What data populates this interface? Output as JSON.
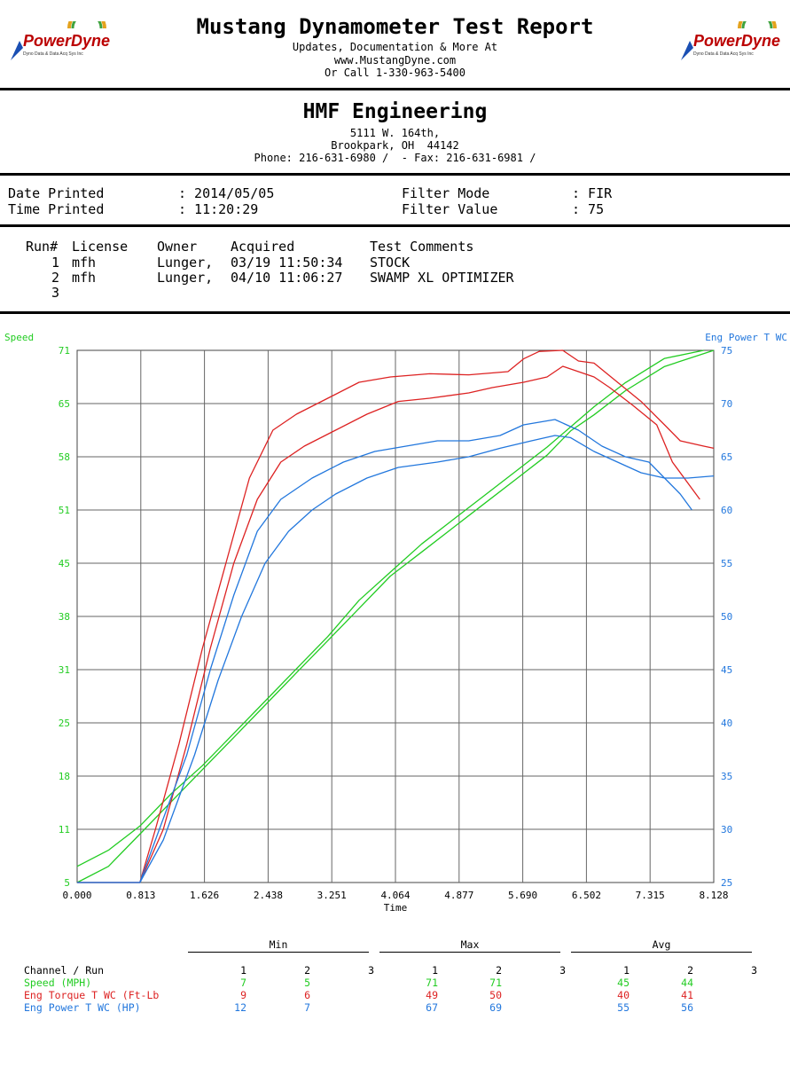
{
  "header": {
    "title": "Mustang Dynamometer Test Report",
    "line1": "Updates, Documentation & More At",
    "line2": "www.MustangDyne.com",
    "line3": "Or Call 1-330-963-5400",
    "logo_text": "PowerDyne",
    "logo_small": "Dyno Data & Data Acq Sys Inc"
  },
  "company": {
    "name": "HMF Engineering",
    "address1": "5111 W. 164th,",
    "address2": "Brookpark, OH  44142",
    "phone": "Phone: 216-631-6980 /  - Fax: 216-631-6981 /"
  },
  "info": {
    "date_label": "Date Printed",
    "date_value": ": 2014/05/05",
    "time_label": "Time Printed",
    "time_value": ": 11:20:29",
    "filter_mode_label": "Filter Mode",
    "filter_mode_value": ": FIR",
    "filter_value_label": "Filter Value",
    "filter_value_value": ": 75"
  },
  "runs": {
    "headers": [
      "Run#",
      "License",
      "Owner",
      "Acquired",
      "Test Comments"
    ],
    "rows": [
      [
        "1",
        "mfh",
        "Lunger,",
        "03/19 11:50:34",
        "STOCK"
      ],
      [
        "2",
        "mfh",
        "Lunger,",
        "04/10 11:06:27",
        "SWAMP XL OPTIMIZER"
      ],
      [
        "3",
        "",
        "",
        "",
        ""
      ]
    ]
  },
  "colors": {
    "speed": "#22cc22",
    "torque": "#dd2222",
    "power": "#2277dd",
    "grid": "#666666"
  },
  "chart_data": {
    "type": "line",
    "xlabel": "Time",
    "ylabel_left": "Speed",
    "ylabel_right": "Eng Power T WC",
    "xlim": [
      0,
      8.128
    ],
    "ylim_left": [
      5,
      71
    ],
    "ylim_right": [
      25,
      75
    ],
    "x_ticks": [
      "0.000",
      "0.813",
      "1.626",
      "2.438",
      "3.251",
      "4.064",
      "4.877",
      "5.690",
      "6.502",
      "7.315",
      "8.128"
    ],
    "y_left_ticks": [
      "5",
      "11",
      "18",
      "25",
      "31",
      "38",
      "45",
      "51",
      "58",
      "65",
      "71"
    ],
    "y_right_ticks": [
      "25",
      "30",
      "35",
      "40",
      "45",
      "50",
      "55",
      "60",
      "65",
      "70",
      "75"
    ],
    "grid": true,
    "series": [
      {
        "color_key": "speed",
        "axis": "left",
        "points": [
          [
            0,
            5
          ],
          [
            0.4,
            7
          ],
          [
            0.8,
            11
          ],
          [
            1.2,
            15
          ],
          [
            1.6,
            19
          ],
          [
            2.0,
            23
          ],
          [
            2.4,
            27
          ],
          [
            2.8,
            31
          ],
          [
            3.2,
            35
          ],
          [
            3.6,
            39
          ],
          [
            4.0,
            43
          ],
          [
            4.4,
            46
          ],
          [
            4.8,
            49
          ],
          [
            5.2,
            52
          ],
          [
            5.6,
            55
          ],
          [
            6.0,
            58
          ],
          [
            6.3,
            61
          ],
          [
            6.6,
            63
          ],
          [
            7.0,
            66
          ],
          [
            7.5,
            69
          ],
          [
            8.128,
            71
          ]
        ]
      },
      {
        "color_key": "speed",
        "axis": "left",
        "points": [
          [
            0,
            7
          ],
          [
            0.4,
            9
          ],
          [
            0.8,
            12
          ],
          [
            1.2,
            16
          ],
          [
            1.6,
            19.5
          ],
          [
            2.0,
            23.5
          ],
          [
            2.4,
            27.5
          ],
          [
            2.8,
            31.5
          ],
          [
            3.2,
            35.5
          ],
          [
            3.6,
            40
          ],
          [
            4.0,
            43.5
          ],
          [
            4.4,
            47
          ],
          [
            4.8,
            50
          ],
          [
            5.2,
            53
          ],
          [
            5.6,
            56
          ],
          [
            6.0,
            59
          ],
          [
            6.3,
            61.5
          ],
          [
            6.6,
            64
          ],
          [
            7.0,
            67
          ],
          [
            7.5,
            70
          ],
          [
            8.0,
            71
          ]
        ]
      },
      {
        "color_key": "torque",
        "axis": "right",
        "points": [
          [
            0,
            25
          ],
          [
            0.8,
            25
          ],
          [
            1.0,
            30
          ],
          [
            1.3,
            38
          ],
          [
            1.6,
            47
          ],
          [
            1.9,
            55
          ],
          [
            2.2,
            63
          ],
          [
            2.5,
            67.5
          ],
          [
            2.8,
            69
          ],
          [
            3.2,
            70.5
          ],
          [
            3.6,
            72
          ],
          [
            4.0,
            72.5
          ],
          [
            4.5,
            72.8
          ],
          [
            5.0,
            72.7
          ],
          [
            5.5,
            73
          ],
          [
            5.7,
            74.2
          ],
          [
            5.9,
            74.9
          ],
          [
            6.2,
            75
          ],
          [
            6.4,
            74
          ],
          [
            6.6,
            73.8
          ],
          [
            6.9,
            72
          ],
          [
            7.2,
            70.2
          ],
          [
            7.5,
            68
          ],
          [
            7.7,
            66.5
          ],
          [
            8.0,
            66
          ],
          [
            8.128,
            65.8
          ]
        ]
      },
      {
        "color_key": "torque",
        "axis": "right",
        "points": [
          [
            0,
            25
          ],
          [
            0.8,
            25
          ],
          [
            1.1,
            30
          ],
          [
            1.4,
            38
          ],
          [
            1.7,
            47
          ],
          [
            2.0,
            55
          ],
          [
            2.3,
            61
          ],
          [
            2.6,
            64.5
          ],
          [
            2.9,
            66
          ],
          [
            3.3,
            67.5
          ],
          [
            3.7,
            69
          ],
          [
            4.1,
            70.2
          ],
          [
            4.5,
            70.5
          ],
          [
            5.0,
            71
          ],
          [
            5.3,
            71.5
          ],
          [
            5.7,
            72
          ],
          [
            6.0,
            72.5
          ],
          [
            6.2,
            73.5
          ],
          [
            6.4,
            73
          ],
          [
            6.6,
            72.5
          ],
          [
            6.8,
            71.5
          ],
          [
            7.1,
            69.8
          ],
          [
            7.4,
            68
          ],
          [
            7.6,
            64.5
          ],
          [
            7.9,
            61.5
          ],
          [
            7.95,
            61
          ]
        ]
      },
      {
        "color_key": "power",
        "axis": "right",
        "points": [
          [
            0,
            25
          ],
          [
            0.8,
            25
          ],
          [
            1.0,
            29
          ],
          [
            1.4,
            37
          ],
          [
            1.7,
            45
          ],
          [
            2.0,
            52
          ],
          [
            2.3,
            58
          ],
          [
            2.6,
            61
          ],
          [
            3.0,
            63
          ],
          [
            3.4,
            64.5
          ],
          [
            3.8,
            65.5
          ],
          [
            4.2,
            66
          ],
          [
            4.6,
            66.5
          ],
          [
            5.0,
            66.5
          ],
          [
            5.4,
            67
          ],
          [
            5.7,
            68
          ],
          [
            6.1,
            68.5
          ],
          [
            6.4,
            67.5
          ],
          [
            6.7,
            66
          ],
          [
            7.0,
            65
          ],
          [
            7.3,
            64.5
          ],
          [
            7.5,
            63
          ],
          [
            7.7,
            61.5
          ],
          [
            7.85,
            60
          ]
        ]
      },
      {
        "color_key": "power",
        "axis": "right",
        "points": [
          [
            0,
            25
          ],
          [
            0.8,
            25
          ],
          [
            1.1,
            29
          ],
          [
            1.5,
            37
          ],
          [
            1.8,
            44
          ],
          [
            2.1,
            50
          ],
          [
            2.4,
            55
          ],
          [
            2.7,
            58
          ],
          [
            3.0,
            60
          ],
          [
            3.3,
            61.5
          ],
          [
            3.7,
            63
          ],
          [
            4.1,
            64
          ],
          [
            4.6,
            64.5
          ],
          [
            5.0,
            65
          ],
          [
            5.4,
            65.8
          ],
          [
            5.8,
            66.5
          ],
          [
            6.1,
            67
          ],
          [
            6.3,
            66.8
          ],
          [
            6.6,
            65.5
          ],
          [
            6.9,
            64.5
          ],
          [
            7.2,
            63.5
          ],
          [
            7.5,
            63
          ],
          [
            7.8,
            63
          ],
          [
            8.128,
            63.2
          ]
        ]
      }
    ]
  },
  "summary": {
    "groups": [
      "Min",
      "Max",
      "Avg"
    ],
    "header_label": "Channel / Run",
    "run_numbers": [
      "1",
      "2",
      "3"
    ],
    "rows": [
      {
        "label": "Speed (MPH)",
        "color_key": "speed",
        "values": [
          "7",
          "5",
          "",
          "71",
          "71",
          "",
          "45",
          "44",
          ""
        ]
      },
      {
        "label": "Eng Torque T WC (Ft-Lb",
        "color_key": "torque",
        "values": [
          "9",
          "6",
          "",
          "49",
          "50",
          "",
          "40",
          "41",
          ""
        ]
      },
      {
        "label": "Eng Power T WC (HP)",
        "color_key": "power",
        "values": [
          "12",
          "7",
          "",
          "67",
          "69",
          "",
          "55",
          "56",
          ""
        ]
      }
    ]
  }
}
